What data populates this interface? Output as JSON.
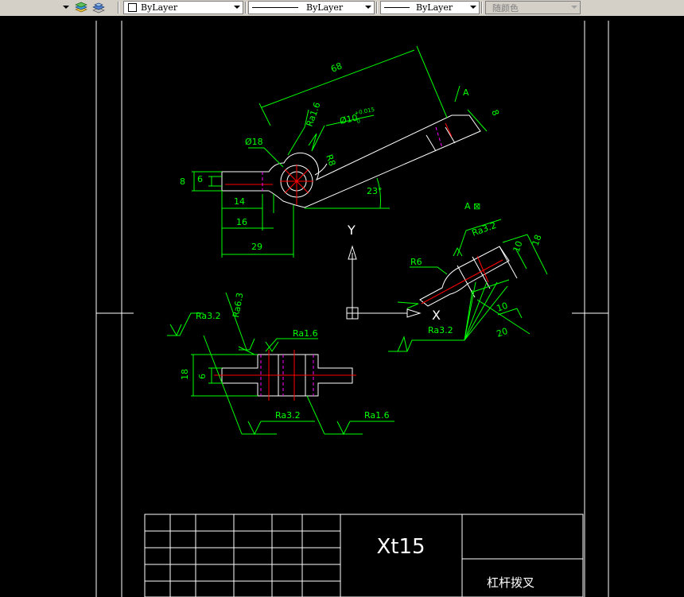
{
  "toolbar": {
    "color_combo": {
      "value": "ByLayer"
    },
    "linetype_combo": {
      "value": "ByLayer"
    },
    "lineweight_combo": {
      "value": "ByLayer"
    },
    "plotstyle_combo": {
      "value": "随颜色"
    }
  },
  "drawing": {
    "top_view": {
      "dim_68": "68",
      "dim_a_section": "A",
      "dim_8_right": "8",
      "dim_phi18": "Ø18",
      "dim_ra16": "Ra1.6",
      "dim_phi10": "Ø10",
      "dim_phi10_tol_upper": "+0.015",
      "dim_phi10_tol_lower": "0",
      "dim_r8": "R8",
      "dim_23deg": "23°",
      "dim_8_left": "8",
      "dim_6_left": "6",
      "dim_14": "14",
      "dim_16": "16",
      "dim_29": "29"
    },
    "ucs": {
      "y_label": "Y",
      "x_label": "X"
    },
    "section_view": {
      "title": "A ⊠",
      "dim_ra32_top": "Ra3.2",
      "dim_r6": "R6",
      "dim_10_top": "10",
      "dim_18": "18",
      "dim_10_bottom": "10",
      "dim_20": "20",
      "dim_ra32_bottom": "Ra3.2"
    },
    "front_view": {
      "dim_ra32_left": "Ra3.2",
      "dim_ra63": "Ra6.3",
      "dim_ra16_top": "Ra1.6",
      "dim_18": "18",
      "dim_6": "6",
      "dim_ra32_bottom": "Ra3.2",
      "dim_ra16_bottom": "Ra1.6"
    },
    "title_block": {
      "drawing_code": "Xt15",
      "part_name": "杠杆拨叉"
    }
  }
}
